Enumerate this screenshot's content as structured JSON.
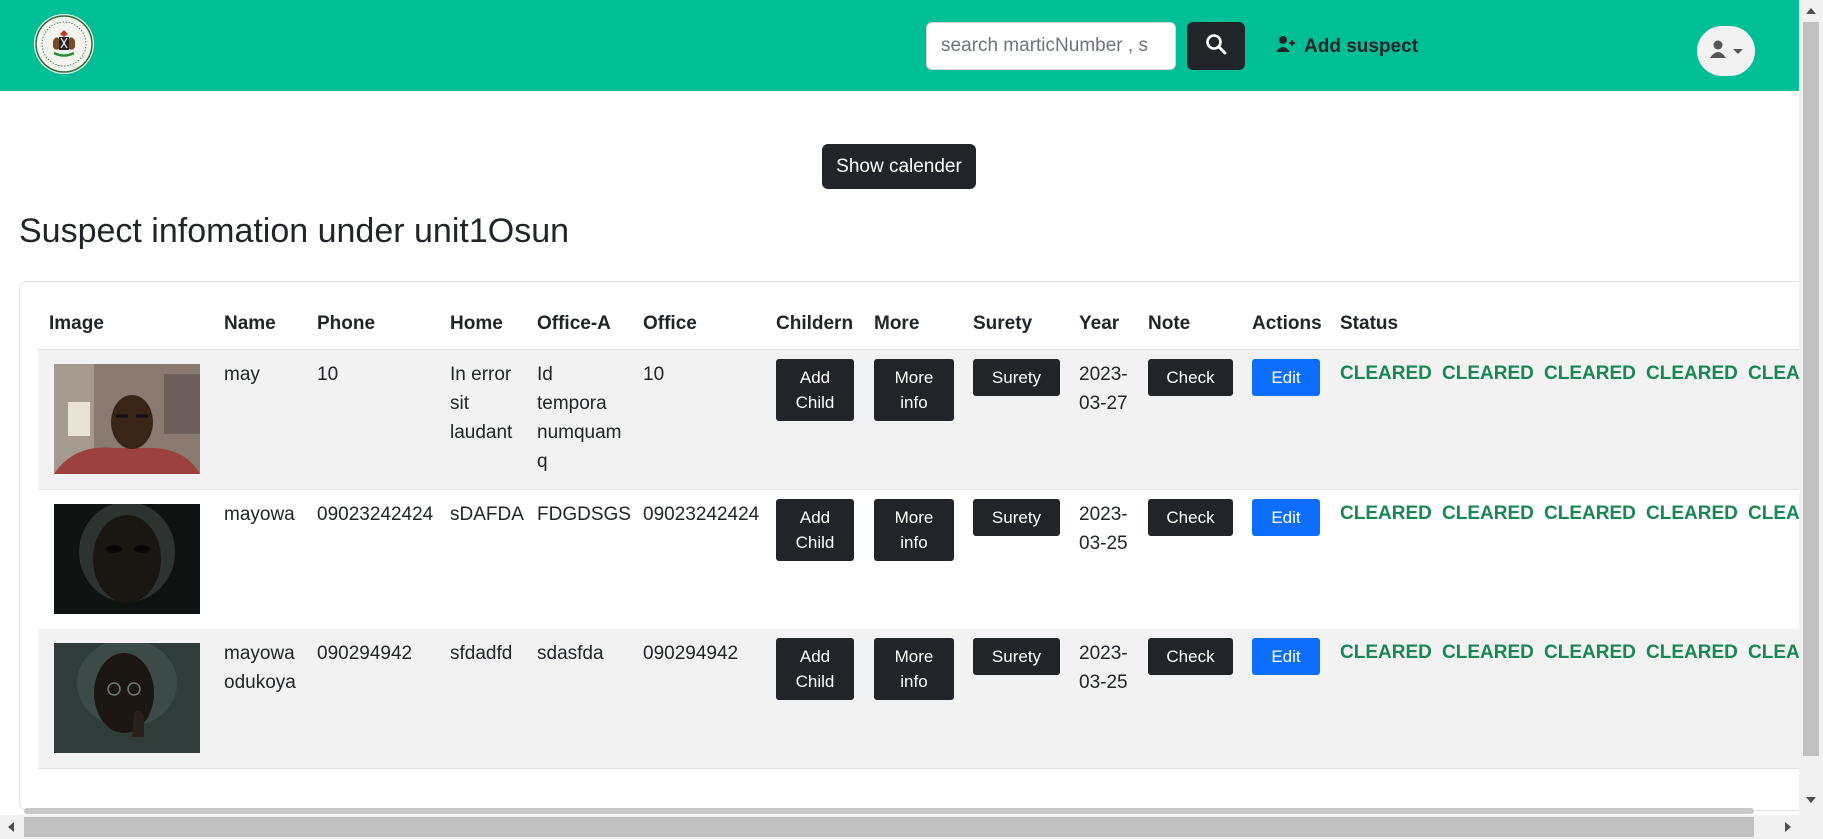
{
  "navbar": {
    "logo": "nigeria-coat-of-arms-logo",
    "search_placeholder": "search marticNumber , s",
    "search_icon": "search-icon",
    "add_suspect_label": "Add suspect",
    "add_suspect_icon": "user-plus-icon",
    "avatar_icon": "user-icon"
  },
  "show_calendar_label": "Show calender",
  "page_title": "Suspect infomation under unit1Osun",
  "table": {
    "headers": [
      "Image",
      "Name",
      "Phone",
      "Home",
      "Office-A",
      "Office",
      "Childern",
      "More",
      "Surety",
      "Year",
      "Note",
      "Actions",
      "Status"
    ],
    "add_child_line1": "Add",
    "add_child_line2": "Child",
    "more_info_line1": "More",
    "more_info_line2": "info",
    "surety_label": "Surety",
    "check_label": "Check",
    "edit_label": "Edit",
    "status_text": "CLEARED",
    "rows": [
      {
        "name_line1": "may",
        "name_line2": "",
        "phone": "10",
        "home_line1": "In error",
        "home_line2": "sit",
        "home_line3": "laudant",
        "office_a_line1": "Id",
        "office_a_line2": "tempora",
        "office_a_line3": "numquam",
        "office_a_line4": "q",
        "office": "10",
        "year_line1": "2023-",
        "year_line2": "03-27"
      },
      {
        "name_line1": "mayowa",
        "name_line2": "",
        "phone": "09023242424",
        "home_line1": "sDAFDA",
        "home_line2": "",
        "home_line3": "",
        "office_a_line1": "FDGDSGS",
        "office_a_line2": "",
        "office_a_line3": "",
        "office_a_line4": "",
        "office": "09023242424",
        "year_line1": "2023-",
        "year_line2": "03-25"
      },
      {
        "name_line1": "mayowa",
        "name_line2": "odukoya",
        "phone": "090294942",
        "home_line1": "sfdadfd",
        "home_line2": "",
        "home_line3": "",
        "office_a_line1": "sdasfda",
        "office_a_line2": "",
        "office_a_line3": "",
        "office_a_line4": "",
        "office": "090294942",
        "year_line1": "2023-",
        "year_line2": "03-25"
      }
    ]
  },
  "colors": {
    "navbar": "#00bf96",
    "dark_button": "#212529",
    "edit_button": "#0d6efd",
    "status": "#198754"
  }
}
